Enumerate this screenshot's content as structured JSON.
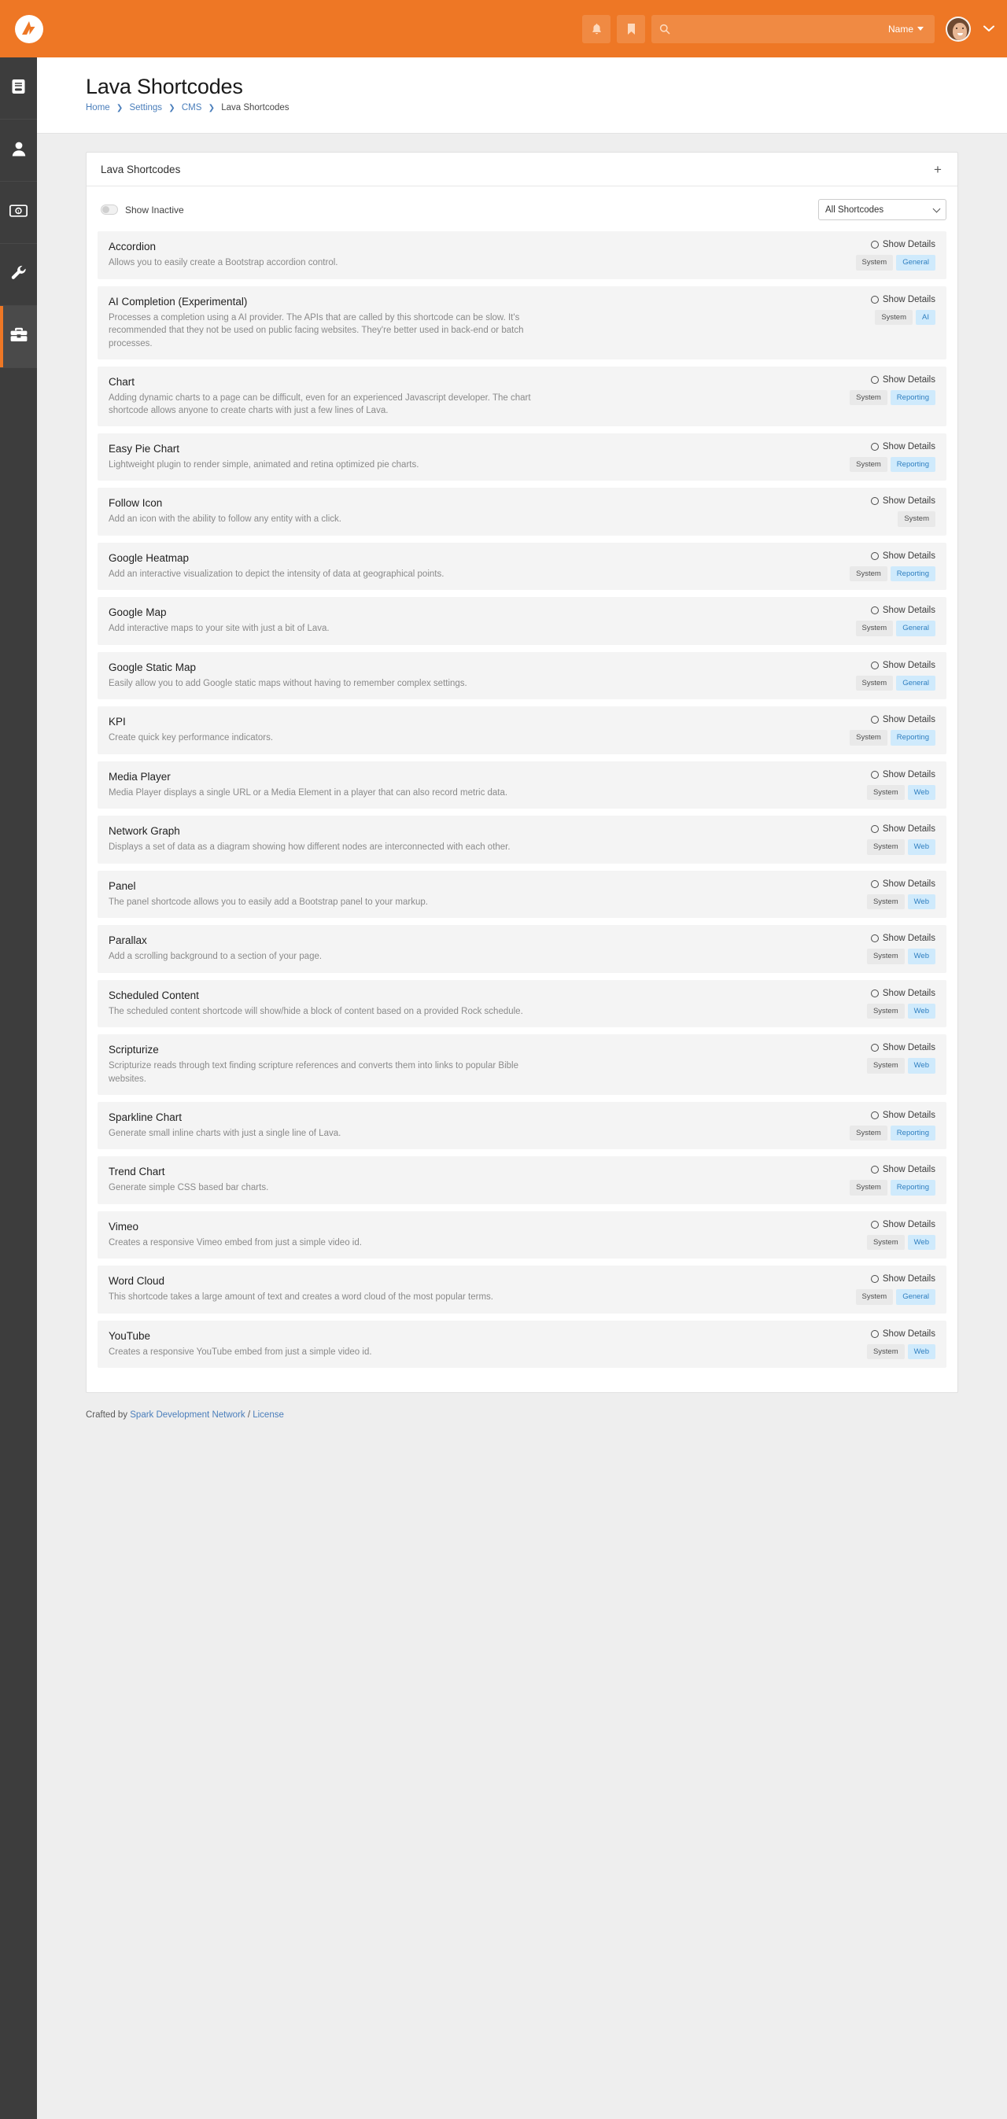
{
  "topbar": {
    "logo_name": "rock-rms-logo",
    "notification_icon": "bell-icon",
    "bookmark_icon": "bookmark-icon",
    "search_icon": "search-icon",
    "search_value": "",
    "search_placeholder": "",
    "search_scope": "Name",
    "avatar_label": "user-avatar",
    "user_menu_caret": "⌄"
  },
  "sidebar": {
    "items": [
      {
        "name": "sidebar-item-cms",
        "icon": "file-text-icon",
        "active": false
      },
      {
        "name": "sidebar-item-people",
        "icon": "person-icon",
        "active": false
      },
      {
        "name": "sidebar-item-finance",
        "icon": "money-bill-icon",
        "active": false
      },
      {
        "name": "sidebar-item-tools",
        "icon": "wrench-icon",
        "active": false
      },
      {
        "name": "sidebar-item-admin",
        "icon": "toolbox-icon",
        "active": true
      }
    ]
  },
  "header": {
    "title": "Lava Shortcodes",
    "breadcrumb": [
      {
        "label": "Home",
        "link": true
      },
      {
        "label": "Settings",
        "link": true
      },
      {
        "label": "CMS",
        "link": true
      },
      {
        "label": "Lava Shortcodes",
        "link": false
      }
    ],
    "breadcrumb_separator": "❯"
  },
  "panel": {
    "title": "Lava Shortcodes",
    "add_button_label": "+",
    "toggle_label": "Show Inactive",
    "toggle_on": false,
    "filter_selected": "All Shortcodes",
    "filter_options": [
      "All Shortcodes"
    ]
  },
  "item_defaults": {
    "show_details_label": "Show Details"
  },
  "shortcodes": [
    {
      "name": "Accordion",
      "description": "Allows you to easily create a Bootstrap accordion control.",
      "badges": [
        {
          "label": "System",
          "style": "system"
        },
        {
          "label": "General",
          "style": "blue"
        }
      ]
    },
    {
      "name": "AI Completion (Experimental)",
      "description": "Processes a completion using a AI provider. The APIs that are called by this shortcode can be slow. It's recommended that they not be used on public facing websites. They're better used in back-end or batch processes.",
      "badges": [
        {
          "label": "System",
          "style": "system"
        },
        {
          "label": "AI",
          "style": "blue"
        }
      ]
    },
    {
      "name": "Chart",
      "description": "Adding dynamic charts to a page can be difficult, even for an experienced Javascript developer. The chart shortcode allows anyone to create charts with just a few lines of Lava.",
      "badges": [
        {
          "label": "System",
          "style": "system"
        },
        {
          "label": "Reporting",
          "style": "blue"
        }
      ]
    },
    {
      "name": "Easy Pie Chart",
      "description": "Lightweight plugin to render simple, animated and retina optimized pie charts.",
      "badges": [
        {
          "label": "System",
          "style": "system"
        },
        {
          "label": "Reporting",
          "style": "blue"
        }
      ]
    },
    {
      "name": "Follow Icon",
      "description": "Add an icon with the ability to follow any entity with a click.",
      "badges": [
        {
          "label": "System",
          "style": "system"
        }
      ]
    },
    {
      "name": "Google Heatmap",
      "description": "Add an interactive visualization to depict the intensity of data at geographical points.",
      "badges": [
        {
          "label": "System",
          "style": "system"
        },
        {
          "label": "Reporting",
          "style": "blue"
        }
      ]
    },
    {
      "name": "Google Map",
      "description": "Add interactive maps to your site with just a bit of Lava.",
      "badges": [
        {
          "label": "System",
          "style": "system"
        },
        {
          "label": "General",
          "style": "blue"
        }
      ]
    },
    {
      "name": "Google Static Map",
      "description": "Easily allow you to add Google static maps without having to remember complex settings.",
      "badges": [
        {
          "label": "System",
          "style": "system"
        },
        {
          "label": "General",
          "style": "blue"
        }
      ]
    },
    {
      "name": "KPI",
      "description": "Create quick key performance indicators.",
      "badges": [
        {
          "label": "System",
          "style": "system"
        },
        {
          "label": "Reporting",
          "style": "blue"
        }
      ]
    },
    {
      "name": "Media Player",
      "description": "Media Player displays a single URL or a Media Element in a player that can also record metric data.",
      "badges": [
        {
          "label": "System",
          "style": "system"
        },
        {
          "label": "Web",
          "style": "blue"
        }
      ]
    },
    {
      "name": "Network Graph",
      "description": "Displays a set of data as a diagram showing how different nodes are interconnected with each other.",
      "badges": [
        {
          "label": "System",
          "style": "system"
        },
        {
          "label": "Web",
          "style": "blue"
        }
      ]
    },
    {
      "name": "Panel",
      "description": "The panel shortcode allows you to easily add a Bootstrap panel to your markup.",
      "badges": [
        {
          "label": "System",
          "style": "system"
        },
        {
          "label": "Web",
          "style": "blue"
        }
      ]
    },
    {
      "name": "Parallax",
      "description": "Add a scrolling background to a section of your page.",
      "badges": [
        {
          "label": "System",
          "style": "system"
        },
        {
          "label": "Web",
          "style": "blue"
        }
      ]
    },
    {
      "name": "Scheduled Content",
      "description": "The scheduled content shortcode will show/hide a block of content based on a provided Rock schedule.",
      "badges": [
        {
          "label": "System",
          "style": "system"
        },
        {
          "label": "Web",
          "style": "blue"
        }
      ]
    },
    {
      "name": "Scripturize",
      "description": "Scripturize reads through text finding scripture references and converts them into links to popular Bible websites.",
      "badges": [
        {
          "label": "System",
          "style": "system"
        },
        {
          "label": "Web",
          "style": "blue"
        }
      ]
    },
    {
      "name": "Sparkline Chart",
      "description": "Generate small inline charts with just a single line of Lava.",
      "badges": [
        {
          "label": "System",
          "style": "system"
        },
        {
          "label": "Reporting",
          "style": "blue"
        }
      ]
    },
    {
      "name": "Trend Chart",
      "description": "Generate simple CSS based bar charts.",
      "badges": [
        {
          "label": "System",
          "style": "system"
        },
        {
          "label": "Reporting",
          "style": "blue"
        }
      ]
    },
    {
      "name": "Vimeo",
      "description": "Creates a responsive Vimeo embed from just a simple video id.",
      "badges": [
        {
          "label": "System",
          "style": "system"
        },
        {
          "label": "Web",
          "style": "blue"
        }
      ]
    },
    {
      "name": "Word Cloud",
      "description": "This shortcode takes a large amount of text and creates a word cloud of the most popular terms.",
      "badges": [
        {
          "label": "System",
          "style": "system"
        },
        {
          "label": "General",
          "style": "blue"
        }
      ]
    },
    {
      "name": "YouTube",
      "description": "Creates a responsive YouTube embed from just a simple video id.",
      "badges": [
        {
          "label": "System",
          "style": "system"
        },
        {
          "label": "Web",
          "style": "blue"
        }
      ]
    }
  ],
  "footer": {
    "prefix": "Crafted by ",
    "org_link": "Spark Development Network",
    "divider": " / ",
    "license_link": "License"
  },
  "colors": {
    "brand_orange": "#ee7725",
    "sidebar_dark": "#3d3d3d",
    "page_bg": "#eeeeee",
    "link_blue": "#4a7ebb",
    "badge_blue_bg": "#cfeafc",
    "badge_blue_text": "#2f7fc0",
    "badge_gray_bg": "#e9e9e9"
  }
}
